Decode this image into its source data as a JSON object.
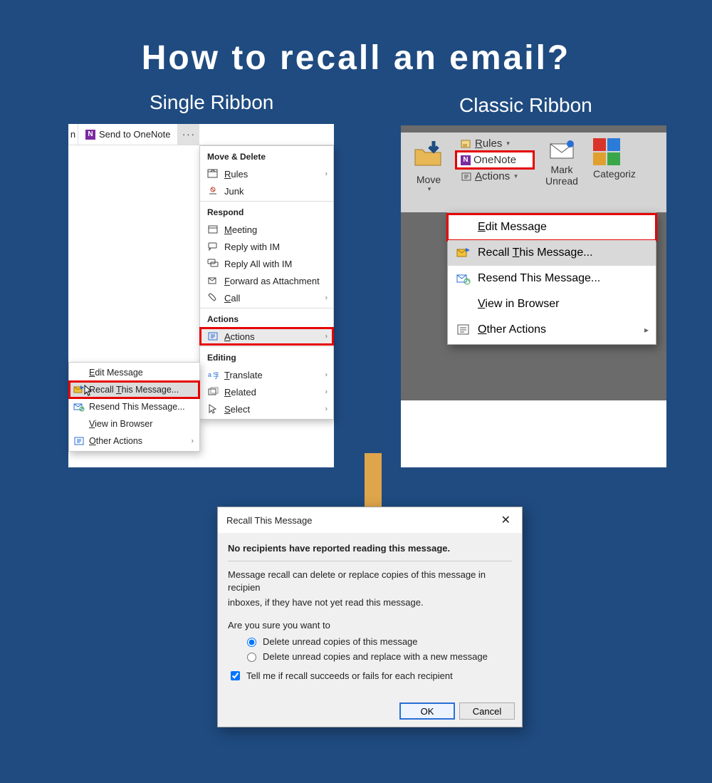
{
  "page_title": "How to recall an email?",
  "left_label": "Single Ribbon",
  "right_label": "Classic Ribbon",
  "single": {
    "ribbon": {
      "truncated_letter": "n",
      "send_to_onenote": "Send to OneNote",
      "more": "···"
    },
    "menu": {
      "group_move": "Move & Delete",
      "rules": "Rules",
      "junk": "Junk",
      "group_respond": "Respond",
      "meeting": "Meeting",
      "reply_im": "Reply with IM",
      "reply_all_im": "Reply All with IM",
      "forward_attachment": "Forward as Attachment",
      "call": "Call",
      "group_actions": "Actions",
      "actions": "Actions",
      "group_editing": "Editing",
      "translate": "Translate",
      "related": "Related",
      "select": "Select"
    },
    "submenu": {
      "edit_message": "Edit Message",
      "recall": "Recall This Message...",
      "resend": "Resend This Message...",
      "view_browser": "View in Browser",
      "other_actions": "Other Actions"
    }
  },
  "classic": {
    "toolbar": {
      "move": "Move",
      "rules": "Rules",
      "onenote": "OneNote",
      "actions": "Actions",
      "mark_unread_line1": "Mark",
      "mark_unread_line2": "Unread",
      "categorize": "Categoriz"
    },
    "menu": {
      "edit_message": "Edit Message",
      "recall": "Recall This Message...",
      "resend": "Resend This Message...",
      "view_browser": "View in Browser",
      "other_actions": "Other Actions"
    }
  },
  "dialog": {
    "title": "Recall This Message",
    "headline": "No recipients have reported reading this message.",
    "explain1": "Message recall can delete or replace copies of this message in recipien",
    "explain2": "inboxes, if they have not yet read this message.",
    "question": "Are you sure you want to",
    "opt_delete": "Delete unread copies of this message",
    "opt_replace": "Delete unread copies and replace with a new message",
    "tell_me": "Tell me if recall succeeds or fails for each recipient",
    "ok": "OK",
    "cancel": "Cancel"
  }
}
